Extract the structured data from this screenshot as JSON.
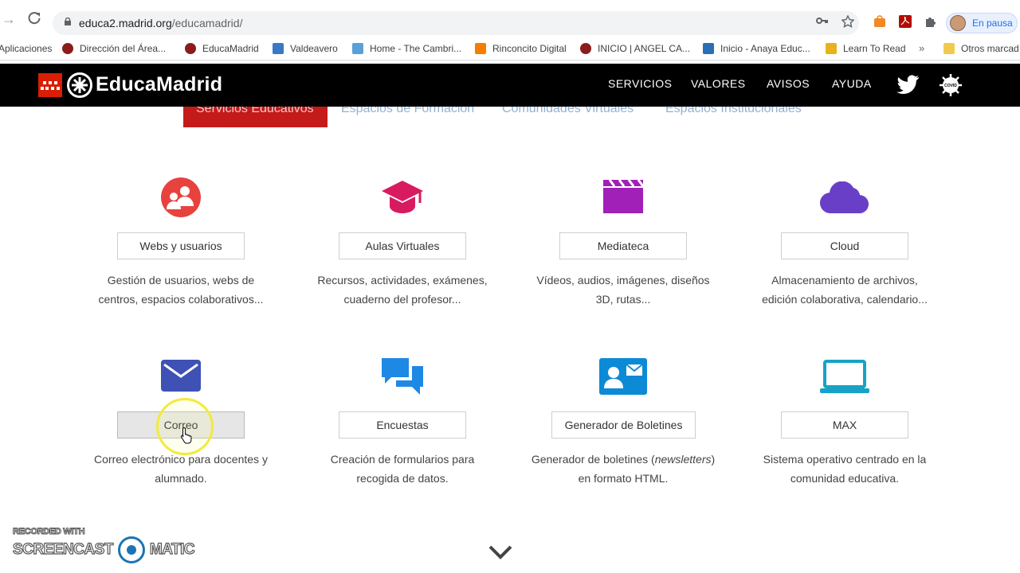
{
  "browser": {
    "url_host": "educa2.madrid.org",
    "url_path": "/educamadrid/",
    "profile_label": "En pausa",
    "bookmarks": [
      {
        "label": "Aplicaciones",
        "color": "#4285f4"
      },
      {
        "label": "Dirección del Área...",
        "color": "#8a1c1c"
      },
      {
        "label": "EducaMadrid",
        "color": "#8a1c1c"
      },
      {
        "label": "Valdeavero",
        "color": "#3b78c4"
      },
      {
        "label": "Home - The Cambri...",
        "color": "#5aa0d8"
      },
      {
        "label": "Rinconcito Digital",
        "color": "#f57d00"
      },
      {
        "label": "INICIO | ANGEL CA...",
        "color": "#8a1c1c"
      },
      {
        "label": "Inicio - Anaya Educ...",
        "color": "#2a6fb5"
      },
      {
        "label": "Learn To Read",
        "color": "#e8b21e"
      },
      {
        "label": "Otros marcad",
        "color": "#f2c94c"
      }
    ],
    "bookmarks_more": "»"
  },
  "site": {
    "logo_text": "EducaMadrid",
    "nav": [
      "SERVICIOS",
      "VALORES",
      "AVISOS",
      "AYUDA"
    ],
    "covid_label": "COVID",
    "tabs": [
      {
        "label": "Servicios Educativos",
        "active": true
      },
      {
        "label": "Espacios de Formación",
        "active": false
      },
      {
        "label": "Comunidades Virtuales",
        "active": false
      },
      {
        "label": "Espacios Institucionales",
        "active": false
      }
    ]
  },
  "services": [
    {
      "name": "Webs y usuarios",
      "desc1": "Gestión de usuarios, webs de",
      "desc2": "centros, espacios colaborativos...",
      "icon": "users-icon",
      "color": "#e8423f"
    },
    {
      "name": "Aulas Virtuales",
      "desc1": "Recursos, actividades, exámenes,",
      "desc2": "cuaderno del profesor...",
      "icon": "graduation-cap-icon",
      "color": "#d81b60"
    },
    {
      "name": "Mediateca",
      "desc1": "Vídeos, audios, imágenes, diseños",
      "desc2": "3D, rutas...",
      "icon": "clapperboard-icon",
      "color": "#a020b8"
    },
    {
      "name": "Cloud",
      "desc1": "Almacenamiento de archivos,",
      "desc2": "edición colaborativa, calendario...",
      "icon": "cloud-icon",
      "color": "#6a3fc8"
    },
    {
      "name": "Correo",
      "desc1": "Correo electrónico para docentes y",
      "desc2": "alumnado.",
      "icon": "envelope-icon",
      "color": "#3f51b5"
    },
    {
      "name": "Encuestas",
      "desc1": "Creación de formularios para",
      "desc2": "recogida de datos.",
      "icon": "chat-bubbles-icon",
      "color": "#1e88e5"
    },
    {
      "name": "Generador de Boletines",
      "desc1_pre": "Generador de boletines (",
      "desc1_em": "newsletters",
      "desc1_post": ")",
      "desc2": "en formato HTML.",
      "icon": "contact-card-icon",
      "color": "#0d8ad6"
    },
    {
      "name": "MAX",
      "desc1": "Sistema operativo centrado en la",
      "desc2": "comunidad educativa.",
      "icon": "laptop-icon",
      "color": "#17a2c7"
    }
  ],
  "watermark": {
    "line1": "RECORDED WITH",
    "left": "SCREENCAST",
    "right": "MATIC"
  }
}
